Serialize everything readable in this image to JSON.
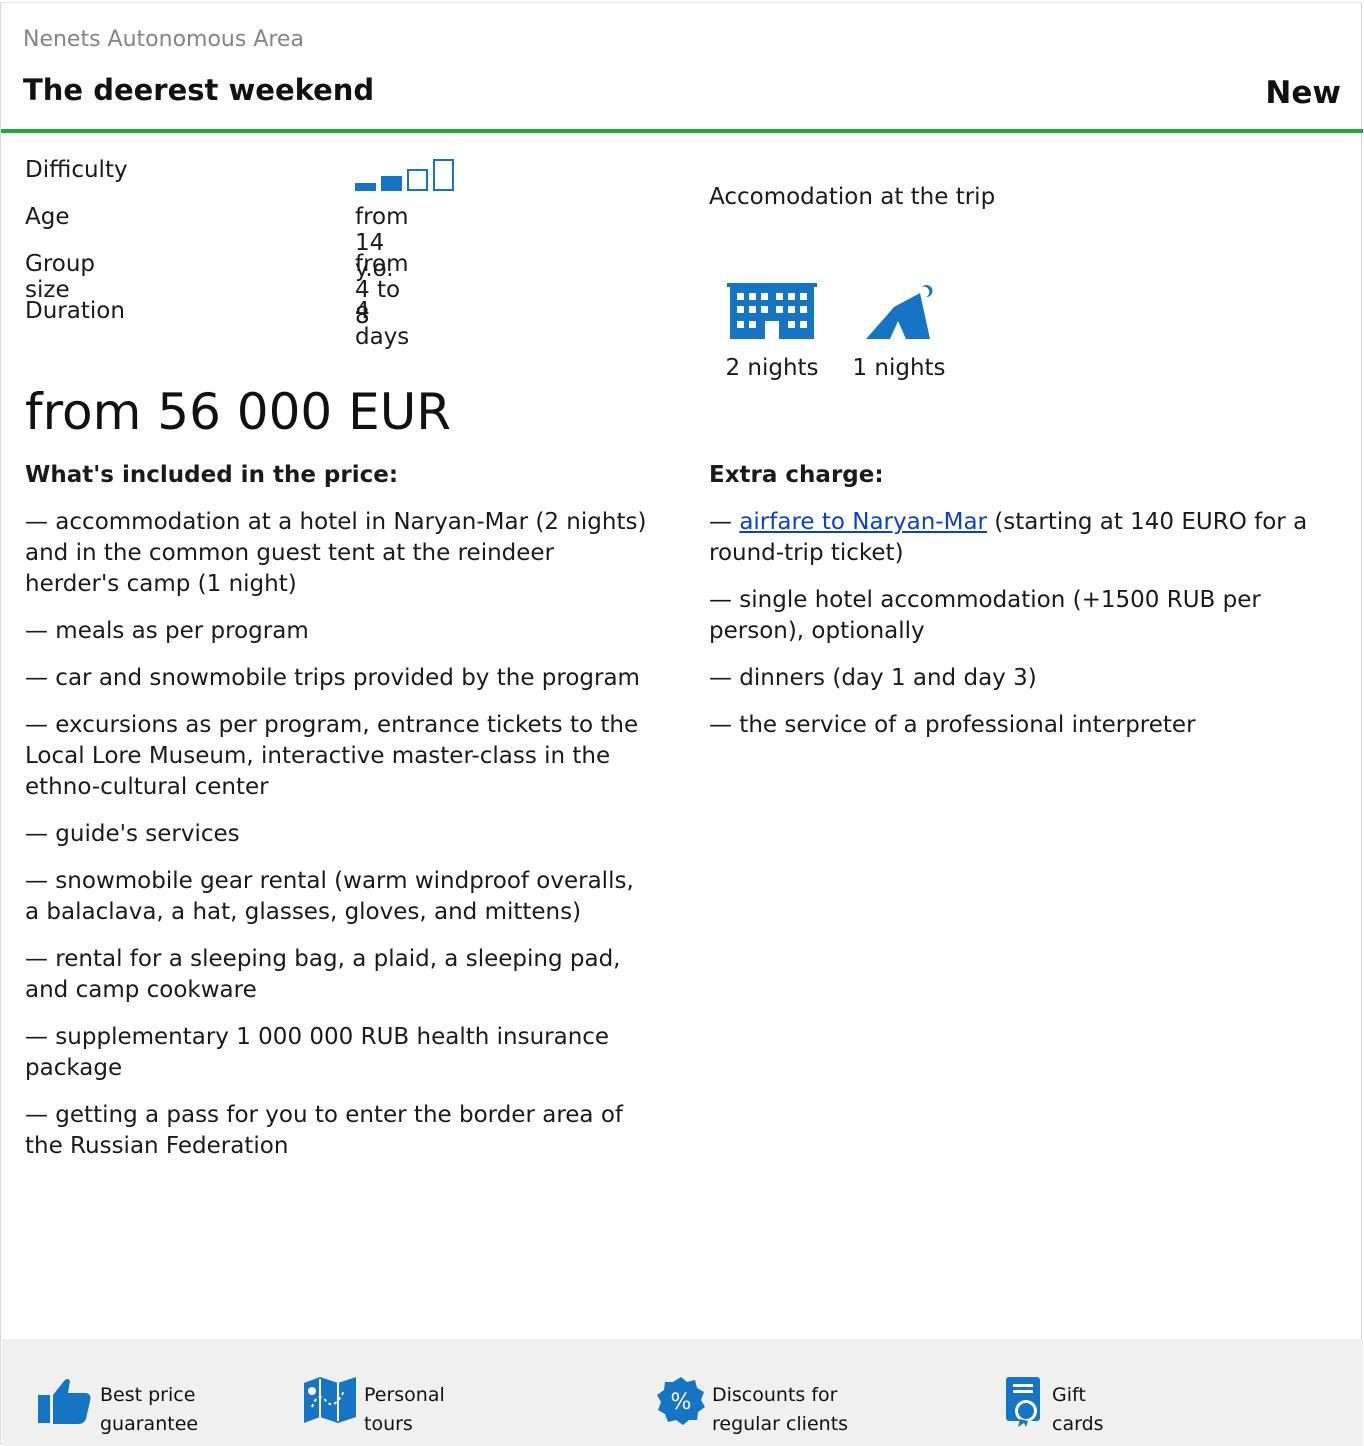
{
  "header": {
    "region": "Nenets Autonomous Area",
    "title": "The deerest weekend",
    "badge": "New"
  },
  "params": {
    "difficulty": {
      "label": "Difficulty",
      "level": 2,
      "max": 4
    },
    "age": {
      "label": "Age",
      "value": "from 14 y.o."
    },
    "group": {
      "label": "Group size",
      "value": "from 4 to 8"
    },
    "duration": {
      "label": "Duration",
      "value": "4 days"
    }
  },
  "price": "from 56 000 EUR",
  "accommodation": {
    "title": "Accomodation at the trip",
    "items": [
      {
        "icon": "hotel-icon",
        "nights": "2 nights"
      },
      {
        "icon": "tent-icon",
        "nights": "1 nights"
      }
    ]
  },
  "included": {
    "heading": "What's included in the price:",
    "items": [
      "— accommodation at a hotel in Naryan-Mar (2 nights) and in the common guest tent at the reindeer herder's camp (1 night)",
      "— meals as per program",
      "— car and snowmobile trips provided by the program",
      "— excursions as per program, entrance tickets to the Local Lore Museum, interactive master-class in the ethno-cultural center",
      "— guide's services",
      "— snowmobile gear rental (warm windproof overalls, a balaclava, a hat, glasses, gloves, and mittens)",
      "— rental for a sleeping bag, a plaid, a sleeping pad, and camp cookware",
      "— supplementary 1 000 000 RUB health insurance package",
      "— getting a pass for you to enter the border area of the Russian Federation"
    ]
  },
  "extra": {
    "heading": "Extra charge:",
    "first_prefix": "— ",
    "first_link": "airfare to Naryan-Mar",
    "first_suffix": " (starting at 140 EURO for a round-trip ticket)",
    "items": [
      "— single hotel accommodation (+1500 RUB per person), optionally",
      "— dinners (day 1 and day 3)",
      "— the service of a professional interpreter"
    ]
  },
  "footer": {
    "items": [
      {
        "icon": "thumbs-up-icon",
        "line1": "Best price",
        "line2": "guarantee"
      },
      {
        "icon": "map-icon",
        "line1": "Personal",
        "line2": "tours"
      },
      {
        "icon": "percent-badge-icon",
        "line1": "Discounts for",
        "line2": "regular clients"
      },
      {
        "icon": "gift-card-icon",
        "line1": "Gift",
        "line2": "cards"
      }
    ]
  },
  "colors": {
    "accent_green": "#1aaa35",
    "icon_blue": "#1674c4",
    "link": "#0b3fd1"
  }
}
